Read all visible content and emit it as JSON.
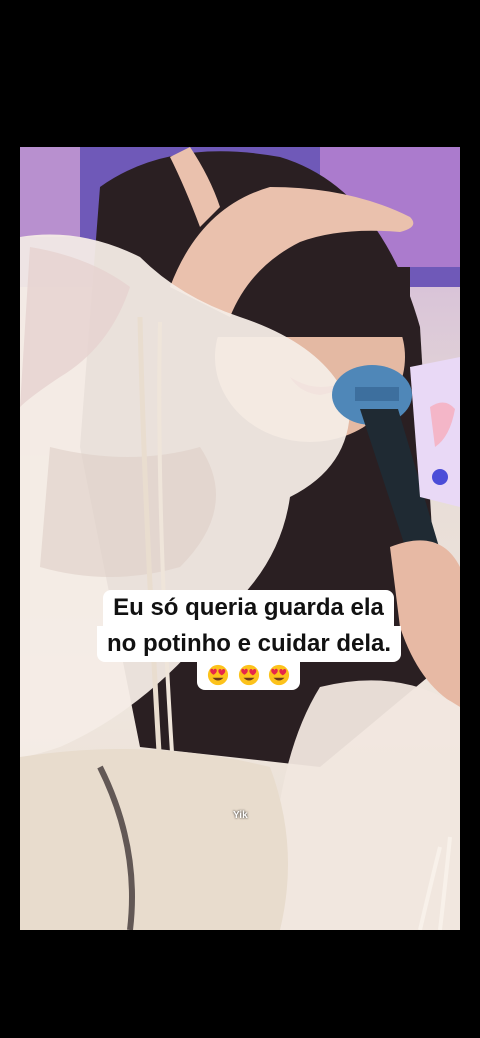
{
  "caption": {
    "line1": "Eu só queria guarda ela",
    "line2": "no potinho e cuidar dela."
  },
  "emojis": [
    "heart-eyes-icon",
    "heart-eyes-icon",
    "heart-eyes-icon"
  ],
  "watermark": "Yik",
  "colors": {
    "background": "#000000",
    "caption_bg": "#ffffff",
    "caption_text": "#111111",
    "stage_purple": "#8a6fc2"
  }
}
